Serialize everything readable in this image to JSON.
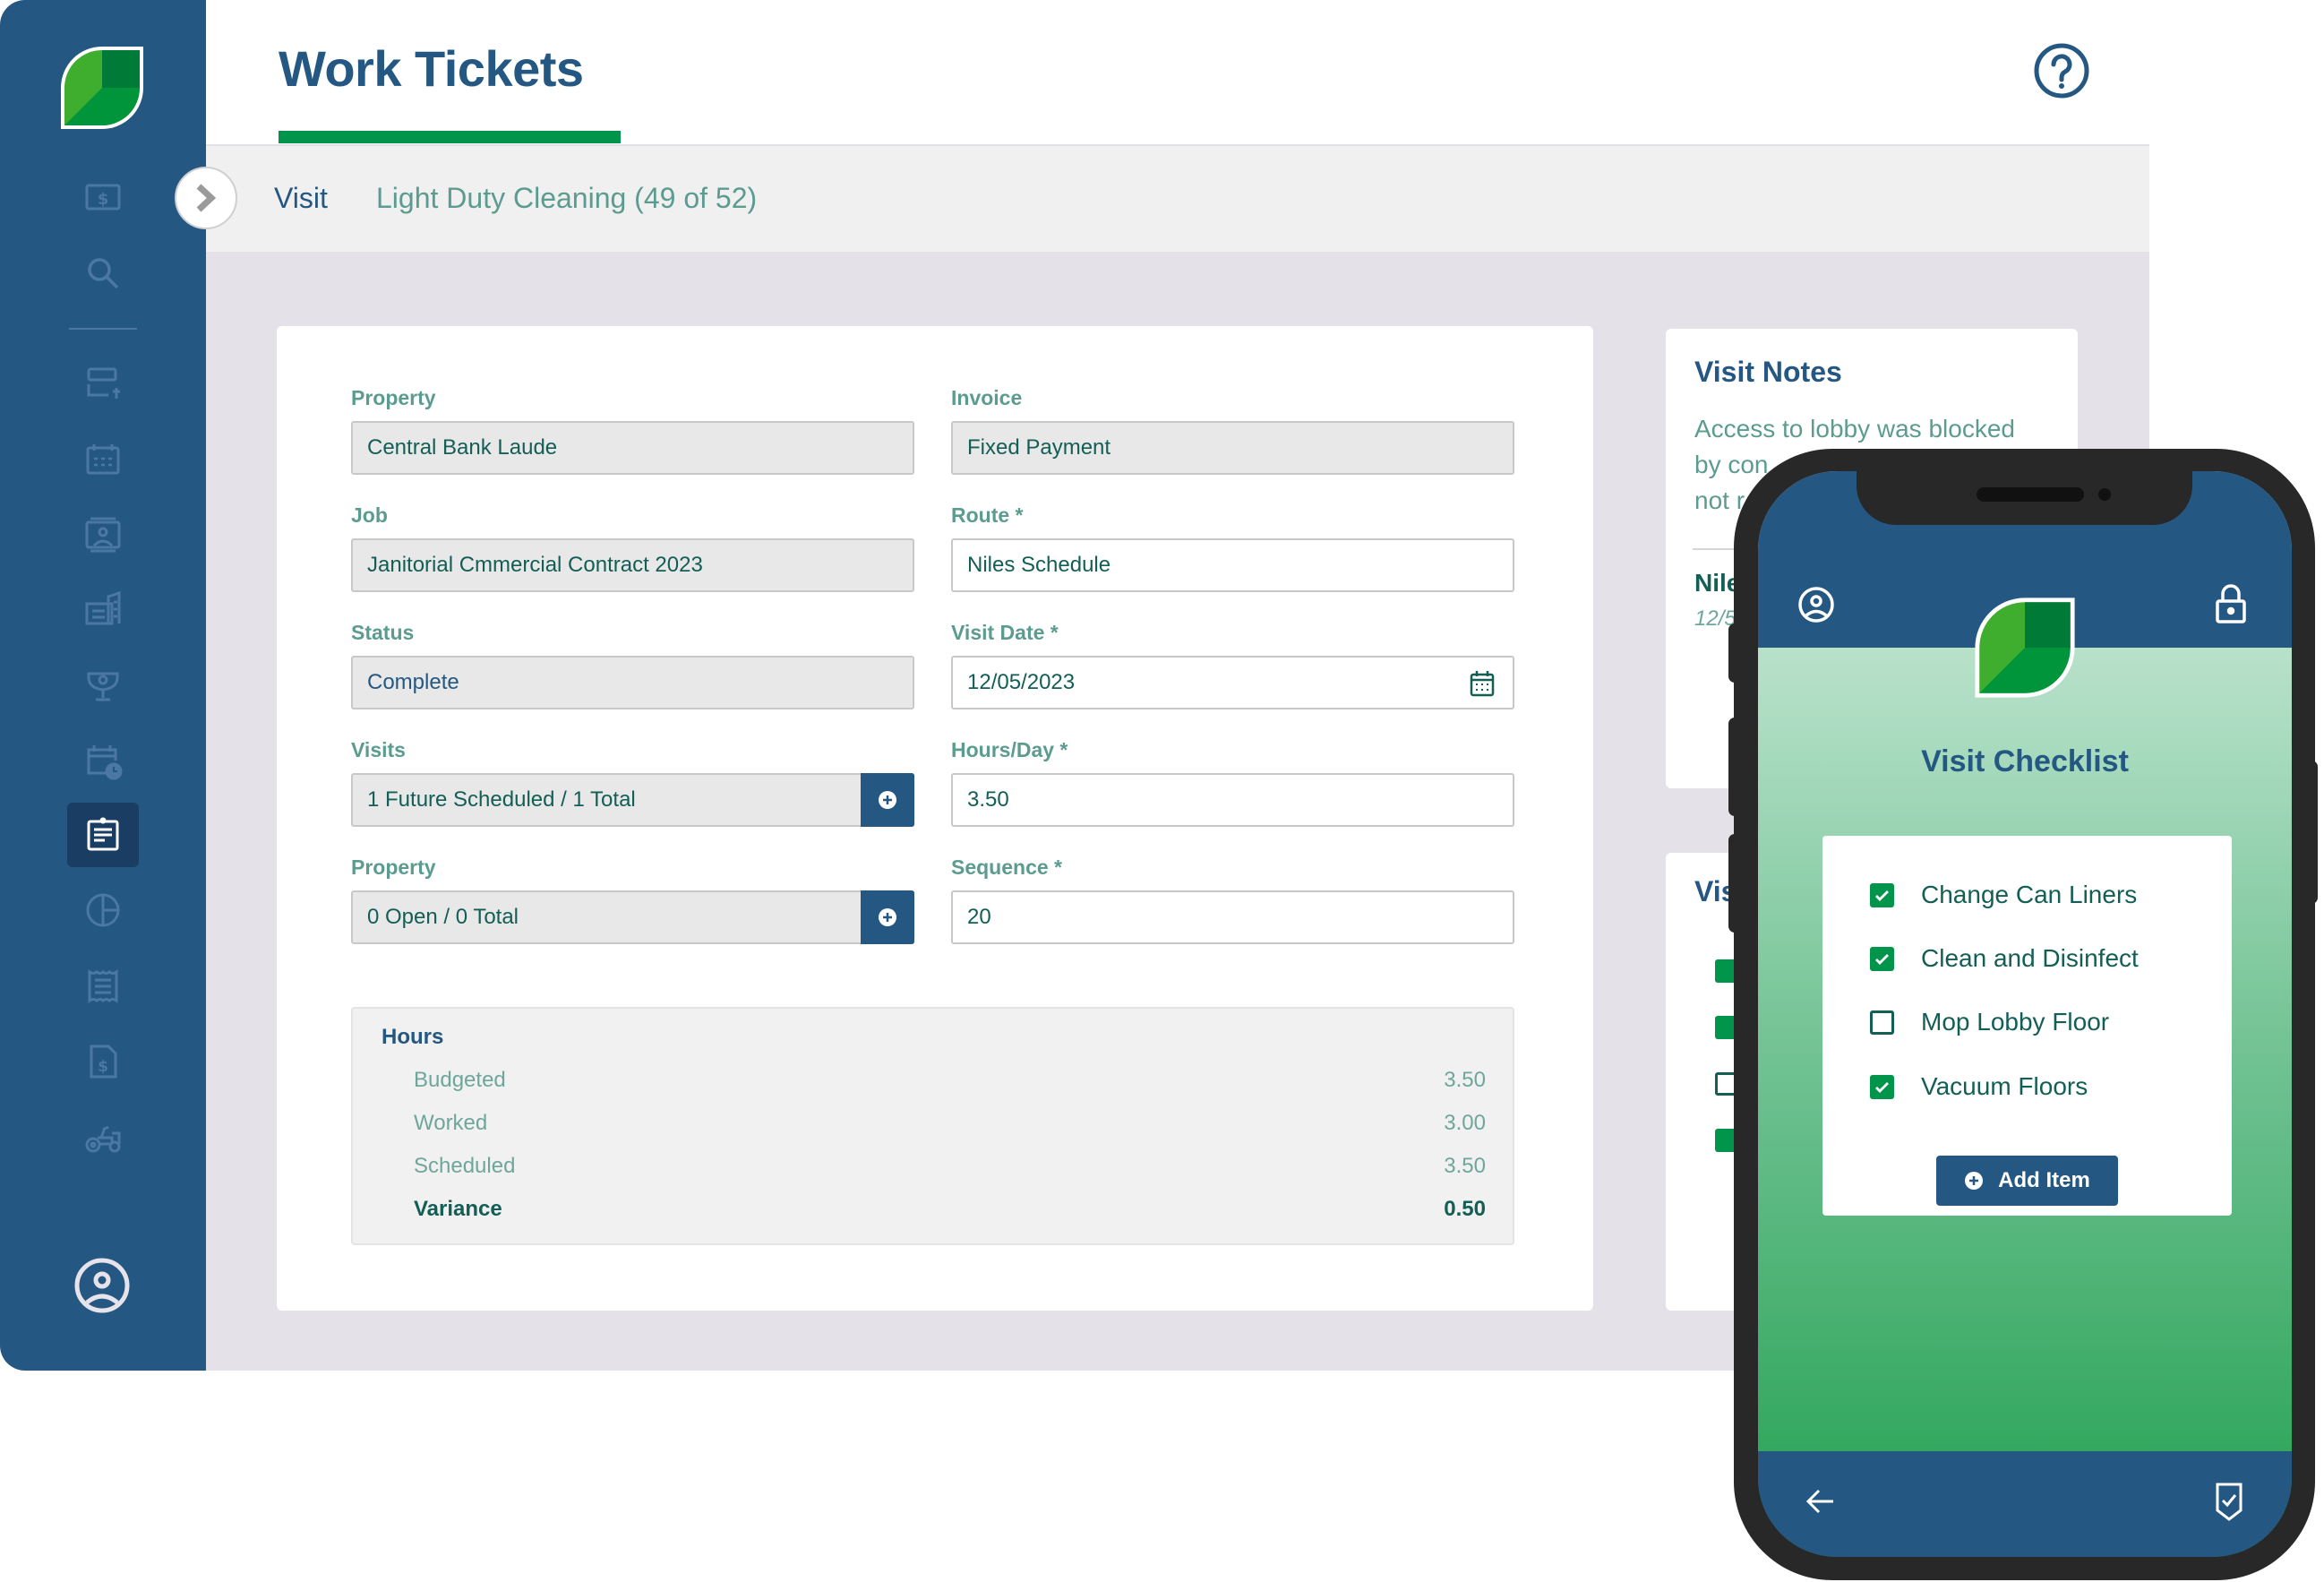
{
  "colors": {
    "brand_blue": "#245782",
    "brand_green": "#00954a",
    "teal_text": "#135e55",
    "label_teal": "#5c9c90",
    "content_bg": "#e5e1e8"
  },
  "sidebar": {
    "items": [
      {
        "icon": "dollar-bill-icon",
        "label": "Billing"
      },
      {
        "icon": "search-icon",
        "label": "Search"
      },
      {
        "icon": "add-list-icon",
        "label": "New"
      },
      {
        "icon": "calendar-icon",
        "label": "Calendar"
      },
      {
        "icon": "contact-card-icon",
        "label": "Contacts"
      },
      {
        "icon": "buildings-icon",
        "label": "Properties"
      },
      {
        "icon": "trophy-icon",
        "label": "Awards"
      },
      {
        "icon": "calendar-clock-icon",
        "label": "Schedule"
      },
      {
        "icon": "clipboard-icon",
        "label": "Work Tickets",
        "active": true
      },
      {
        "icon": "pie-chart-icon",
        "label": "Reports"
      },
      {
        "icon": "receipt-icon",
        "label": "Receipts"
      },
      {
        "icon": "invoice-icon",
        "label": "Invoices"
      },
      {
        "icon": "tractor-icon",
        "label": "Equipment"
      }
    ],
    "profile_icon": "user-circle-icon"
  },
  "header": {
    "title": "Work Tickets",
    "help_icon": "question-circle-icon"
  },
  "tabs": {
    "visit": "Visit",
    "task": "Light Duty Cleaning (49 of 52)"
  },
  "form": {
    "left": [
      {
        "label": "Property",
        "value": "Central Bank Laude",
        "editable": false
      },
      {
        "label": "Job",
        "value": "Janitorial Cmmercial Contract 2023",
        "editable": false
      },
      {
        "label": "Status",
        "value": "Complete",
        "editable": false
      },
      {
        "label": "Visits",
        "value": "1 Future Scheduled / 1 Total",
        "editable": false,
        "has_add": true
      },
      {
        "label": "Property",
        "value": "0 Open / 0 Total",
        "editable": false,
        "has_add": true
      }
    ],
    "right": [
      {
        "label": "Invoice",
        "value": "Fixed Payment",
        "editable": false
      },
      {
        "label": "Route *",
        "value": "Niles Schedule",
        "editable": true
      },
      {
        "label": "Visit Date *",
        "value": "12/05/2023",
        "editable": true,
        "has_calendar": true
      },
      {
        "label": "Hours/Day *",
        "value": "3.50",
        "editable": true
      },
      {
        "label": "Sequence *",
        "value": "20",
        "editable": true
      }
    ]
  },
  "hours": {
    "title": "Hours",
    "rows": [
      {
        "label": "Budgeted",
        "value": "3.50"
      },
      {
        "label": "Worked",
        "value": "3.00"
      },
      {
        "label": "Scheduled",
        "value": "3.50"
      },
      {
        "label": "Variance",
        "value": "0.50",
        "total": true
      }
    ]
  },
  "visit_notes": {
    "title": "Visit Notes",
    "text": "Access to lobby was blocked by cons... not r...",
    "text_visible_line1": "Access to lobby was blocked",
    "text_visible_line2": "by con",
    "text_visible_line3": "not r",
    "author": "Nile",
    "date": "12/5"
  },
  "visit_checklist_panel": {
    "title": "Vis",
    "checks": [
      true,
      true,
      false,
      true
    ]
  },
  "phone": {
    "checklist_title": "Visit Checklist",
    "items": [
      {
        "label": "Change Can Liners",
        "checked": true
      },
      {
        "label": "Clean and Disinfect",
        "checked": true
      },
      {
        "label": "Mop Lobby Floor",
        "checked": false
      },
      {
        "label": "Vacuum Floors",
        "checked": true
      }
    ],
    "add_item_label": "Add Item"
  }
}
